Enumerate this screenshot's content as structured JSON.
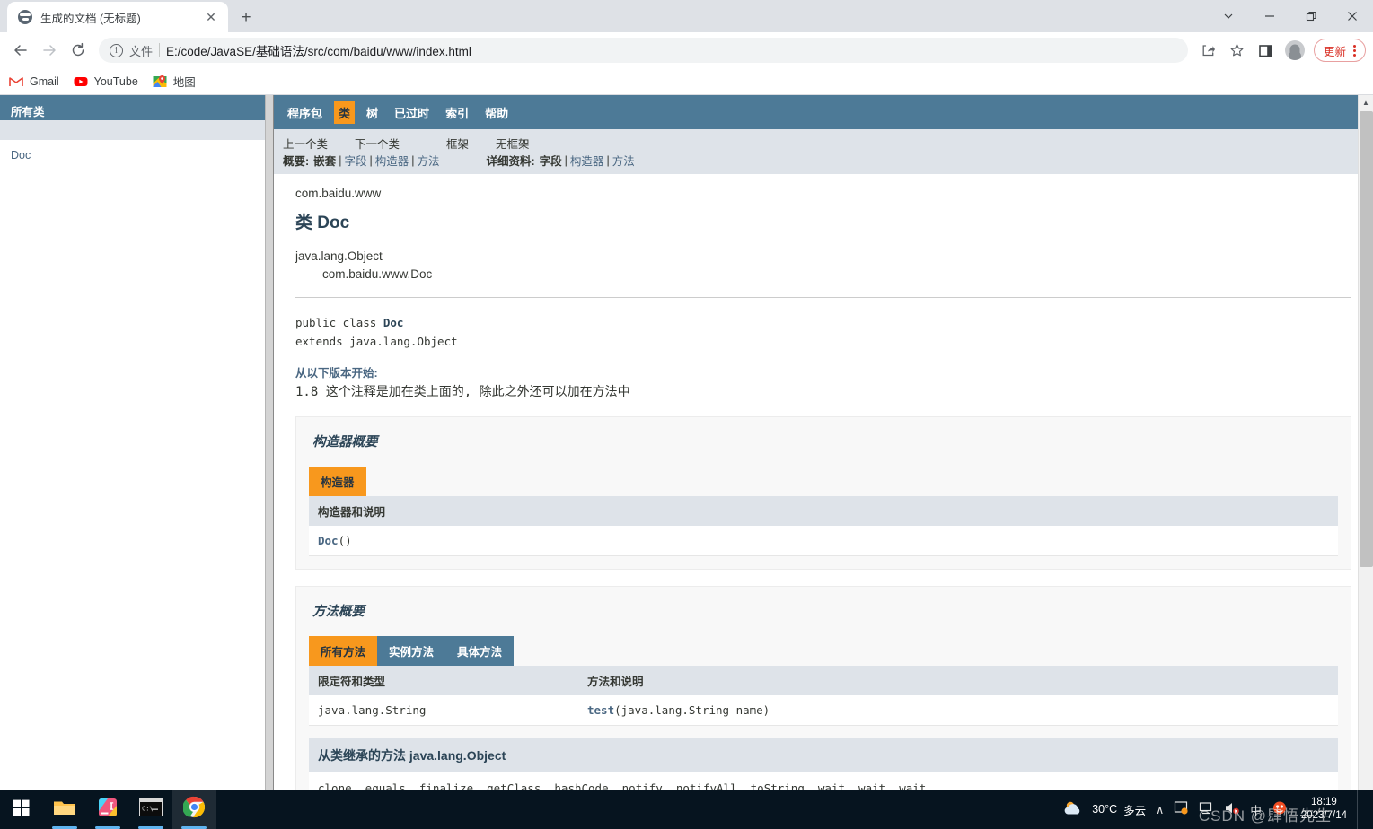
{
  "browser": {
    "tab": {
      "title": "生成的文档 (无标题)",
      "favicon": "globe-icon",
      "close": "✕"
    },
    "new_tab": "+",
    "window_controls": {
      "tab_search": "⌄",
      "minimize": "—",
      "maximize": "❐",
      "close": "✕"
    },
    "toolbar": {
      "back": "←",
      "forward": "→",
      "reload": "⟳",
      "scheme_label": "文件",
      "url": "E:/code/JavaSE/基础语法/src/com/baidu/www/index.html",
      "share": "share-icon",
      "bookmark": "star-icon",
      "side_panel": "side-panel-icon",
      "profile": "avatar",
      "update_label": "更新",
      "menu": "kebab-menu"
    },
    "bookmarks": [
      {
        "label": "Gmail",
        "icon": "gmail-icon"
      },
      {
        "label": "YouTube",
        "icon": "youtube-icon"
      },
      {
        "label": "地图",
        "icon": "maps-icon"
      }
    ]
  },
  "sidebar": {
    "header": "所有类",
    "items": [
      {
        "label": "Doc"
      }
    ]
  },
  "javadoc": {
    "topnav": [
      {
        "label": "程序包",
        "active": false
      },
      {
        "label": "类",
        "active": true
      },
      {
        "label": "树",
        "active": false
      },
      {
        "label": "已过时",
        "active": false
      },
      {
        "label": "索引",
        "active": false
      },
      {
        "label": "帮助",
        "active": false
      }
    ],
    "subnav": {
      "prev": "上一个类",
      "next": "下一个类",
      "frames": "框架",
      "noframes": "无框架",
      "summary_label": "概要:",
      "summary_items": [
        "嵌套",
        "字段",
        "构造器",
        "方法"
      ],
      "detail_label": "详细资料:",
      "detail_items": [
        "字段",
        "构造器",
        "方法"
      ]
    },
    "package": "com.baidu.www",
    "class_title": "类 Doc",
    "hierarchy": [
      "java.lang.Object",
      "com.baidu.www.Doc"
    ],
    "declaration_line1_prefix": "public class ",
    "declaration_line1_name": "Doc",
    "declaration_line2": "extends java.lang.Object",
    "since_label": "从以下版本开始:",
    "since_value": "1.8 这个注释是加在类上面的, 除此之外还可以加在方法中",
    "constructor_summary": {
      "title": "构造器概要",
      "tab": "构造器",
      "header": "构造器和说明",
      "rows": [
        {
          "name": "Doc",
          "signature": "()"
        }
      ]
    },
    "method_summary": {
      "title": "方法概要",
      "tabs": [
        {
          "label": "所有方法",
          "active": true
        },
        {
          "label": "实例方法",
          "active": false
        },
        {
          "label": "具体方法",
          "active": false
        }
      ],
      "col_type": "限定符和类型",
      "col_method": "方法和说明",
      "rows": [
        {
          "type": "java.lang.String",
          "method_name": "test",
          "method_args": "(java.lang.String  name)"
        }
      ]
    },
    "inherited": {
      "heading_prefix": "从类继承的方法 ",
      "heading_class": "java.lang.Object",
      "methods": "clone, equals, finalize, getClass, hashCode, notify, notifyAll, toString, wait, wait, wait"
    }
  },
  "taskbar": {
    "items": [
      {
        "name": "start-button",
        "icon": "windows-logo"
      },
      {
        "name": "file-explorer",
        "icon": "folder-icon"
      },
      {
        "name": "intellij-idea",
        "icon": "idea-icon"
      },
      {
        "name": "command-prompt",
        "icon": "terminal-icon"
      },
      {
        "name": "google-chrome",
        "icon": "chrome-icon"
      }
    ],
    "weather": {
      "temperature": "30°C",
      "condition": "多云"
    },
    "tray": {
      "overflow": "∧",
      "network": "network-icon",
      "display": "display-icon",
      "volume": "volume-muted-icon",
      "ime": "中",
      "app": "app-icon"
    },
    "clock": {
      "time": "18:19",
      "date": "2023/7/14"
    },
    "watermark": "CSDN @肆悟先生"
  },
  "colors": {
    "javadoc_navbar": "#4d7a97",
    "javadoc_active_tab": "#f8981d",
    "javadoc_subnav_bg": "#dee3e9",
    "update_red": "#d93025",
    "taskbar_bg": "#06141f"
  }
}
